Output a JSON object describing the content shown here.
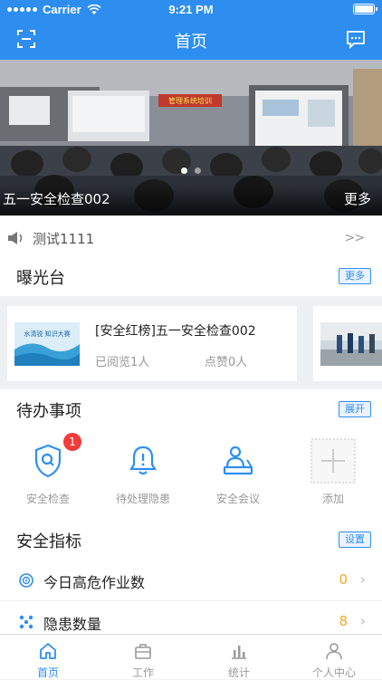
{
  "status_bar": {
    "carrier": "Carrier",
    "time": "9:21 PM"
  },
  "nav": {
    "title": "首页",
    "left_icon": "scan-icon",
    "right_icon": "message-icon"
  },
  "banner": {
    "caption": "五一安全检查002",
    "more": "更多",
    "slide_count": 2,
    "active_slide": 1,
    "photo_sign": "管理系统培训"
  },
  "notice": {
    "icon": "speaker-icon",
    "text": "测试1111",
    "more": ">>"
  },
  "exposure": {
    "title": "曝光台",
    "more_button": "更多",
    "cards": [
      {
        "title": "[安全红榜]五一安全检查002",
        "read": "已阅览1人",
        "likes": "点赞0人",
        "thumb_text": "水清锐 知识大赛"
      }
    ]
  },
  "todo": {
    "title": "待办事项",
    "expand_button": "展开",
    "items": [
      {
        "label": "安全检查",
        "icon": "shield-search-icon",
        "badge": "1"
      },
      {
        "label": "待处理隐患",
        "icon": "bell-alert-icon"
      },
      {
        "label": "安全会议",
        "icon": "meeting-icon"
      },
      {
        "label": "添加",
        "icon": "add-icon"
      }
    ]
  },
  "metrics": {
    "title": "安全指标",
    "settings_button": "设置",
    "rows": [
      {
        "label": "今日高危作业数",
        "value": "0",
        "icon": "danger-icon"
      },
      {
        "label": "隐患数量",
        "value": "8",
        "icon": "hazard-icon"
      }
    ]
  },
  "tabbar": {
    "active": 0,
    "tabs": [
      {
        "label": "首页",
        "icon": "home-icon"
      },
      {
        "label": "工作",
        "icon": "briefcase-icon"
      },
      {
        "label": "统计",
        "icon": "chart-icon"
      },
      {
        "label": "个人中心",
        "icon": "user-icon"
      }
    ]
  },
  "colors": {
    "primary": "#2e8ef0",
    "badge": "#f23b3b",
    "value": "#f5a623"
  }
}
